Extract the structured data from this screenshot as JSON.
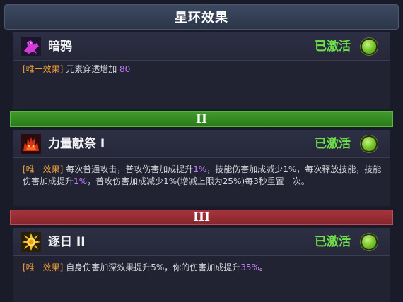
{
  "header": {
    "title": "星环效果"
  },
  "effects": [
    {
      "icon": "raven-icon",
      "name": "暗鸦",
      "status": "已激活",
      "tag": "[唯一效果]",
      "parts": [
        "元素穿透增加",
        "80"
      ]
    },
    {
      "icon": "demon-fire-icon",
      "name": "力量献祭 I",
      "status": "已激活",
      "tag": "[唯一效果]",
      "parts": [
        "每次普通攻击，普攻伤害加成提升",
        "1%",
        "，技能伤害加成减少1%，每次释放技能，技能伤害加成提升",
        "1%",
        "，普攻伤害加成减少1%(增减上限为25%)每3秒重置一次。"
      ]
    },
    {
      "icon": "sun-icon",
      "name": "逐日 II",
      "status": "已激活",
      "tag": "[唯一效果]",
      "parts": [
        "自身伤害加深效果提升5%，你的伤害加成提升",
        "35%",
        "。"
      ]
    }
  ],
  "dividers": {
    "tier2": "II",
    "tier3": "III"
  },
  "colors": {
    "status_green": "#6fe04a",
    "tag_orange": "#e89b3a",
    "highlight_purple": "#c27bff",
    "tier2_bar": "#2f8a22",
    "tier3_bar": "#962e36"
  }
}
